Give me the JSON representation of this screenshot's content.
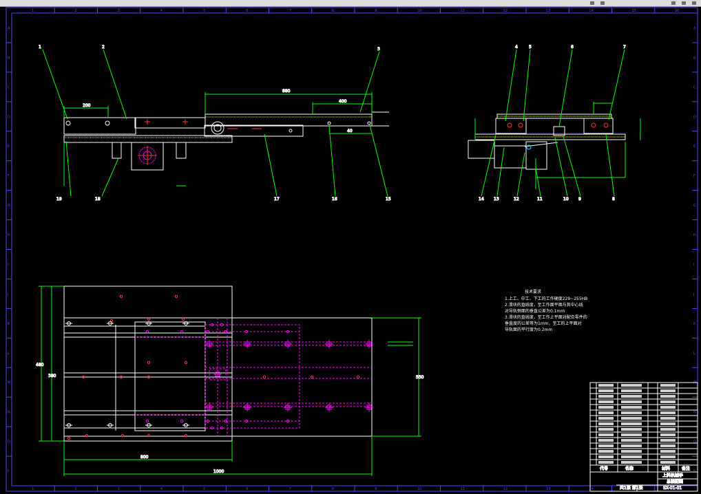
{
  "colors": {
    "background": "#000000",
    "frame": "#4848ff",
    "outline": "#ffffff",
    "dimension": "#00ff00",
    "hidden": "#ff00ff",
    "center": "#ff3333",
    "weld": "#ffff00"
  },
  "frame": {
    "columns": [
      "1",
      "2",
      "3",
      "4",
      "5",
      "6",
      "7",
      "8",
      "9",
      "10",
      "11",
      "12",
      "13",
      "14",
      "15",
      "16"
    ],
    "rows": [
      "A",
      "B",
      "C",
      "D",
      "E",
      "F",
      "G",
      "H",
      "I",
      "J",
      "K",
      "L",
      "M",
      "N",
      "O",
      "P"
    ]
  },
  "front_view": {
    "callouts_top": [
      "1",
      "2",
      "3"
    ],
    "callouts_bottom": [
      "19",
      "18",
      "17",
      "16",
      "15"
    ],
    "dimensions": [
      "880",
      "400",
      "200",
      "40"
    ]
  },
  "side_view": {
    "callouts_top": [
      "4",
      "5",
      "6",
      "7"
    ],
    "callouts_bottom": [
      "14",
      "13",
      "12",
      "11",
      "10",
      "9",
      "8"
    ]
  },
  "plan_view": {
    "dimensions": [
      "800",
      "1000",
      "550",
      "480",
      "380"
    ]
  },
  "notes": {
    "heading": "技术要求",
    "lines": [
      "1.上工、中工、下工的工作硬度229~255HB",
      "2.滑块的直线度，至工作面平面与其中心线",
      "  对导轨侧面的垂直公差为0.1mm",
      "3.滑块的直线度，至工作上平面对配合零件的",
      "  垂直度的公差等为1mm，至工的上平面对",
      "  导轨面的平行度为0.2mm"
    ]
  },
  "title_block": {
    "footer_labels": [
      "代号",
      "名称",
      "材料",
      "备注"
    ],
    "title": "上料机械手",
    "subtitle": "总装配图",
    "drawing_no": "SX-01-01",
    "sheet": "共1张 第1张"
  }
}
